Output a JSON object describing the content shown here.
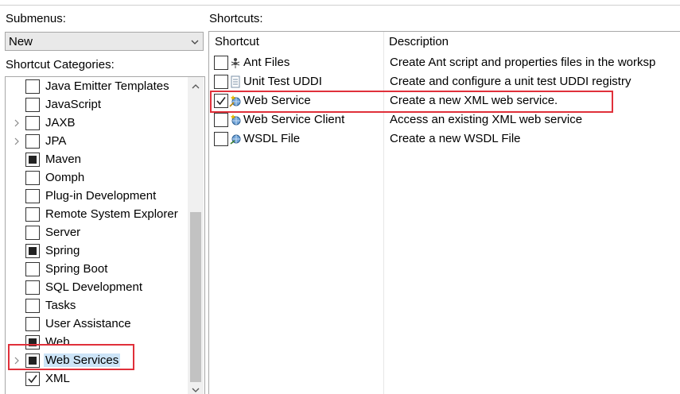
{
  "submenus": {
    "label": "Submenus:",
    "selected": "New"
  },
  "categories": {
    "label": "Shortcut Categories:",
    "items": [
      {
        "label": "Java Emitter Templates",
        "state": "unchecked",
        "expandable": false,
        "selected": false
      },
      {
        "label": "JavaScript",
        "state": "unchecked",
        "expandable": false,
        "selected": false
      },
      {
        "label": "JAXB",
        "state": "unchecked",
        "expandable": true,
        "selected": false
      },
      {
        "label": "JPA",
        "state": "unchecked",
        "expandable": true,
        "selected": false
      },
      {
        "label": "Maven",
        "state": "partial",
        "expandable": false,
        "selected": false
      },
      {
        "label": "Oomph",
        "state": "unchecked",
        "expandable": false,
        "selected": false
      },
      {
        "label": "Plug-in Development",
        "state": "unchecked",
        "expandable": false,
        "selected": false
      },
      {
        "label": "Remote System Explorer",
        "state": "unchecked",
        "expandable": false,
        "selected": false
      },
      {
        "label": "Server",
        "state": "unchecked",
        "expandable": false,
        "selected": false
      },
      {
        "label": "Spring",
        "state": "partial",
        "expandable": false,
        "selected": false
      },
      {
        "label": "Spring Boot",
        "state": "unchecked",
        "expandable": false,
        "selected": false
      },
      {
        "label": "SQL Development",
        "state": "unchecked",
        "expandable": false,
        "selected": false
      },
      {
        "label": "Tasks",
        "state": "unchecked",
        "expandable": false,
        "selected": false
      },
      {
        "label": "User Assistance",
        "state": "unchecked",
        "expandable": false,
        "selected": false
      },
      {
        "label": "Web",
        "state": "partial",
        "expandable": false,
        "selected": false
      },
      {
        "label": "Web Services",
        "state": "partial",
        "expandable": true,
        "selected": true
      },
      {
        "label": "XML",
        "state": "checked",
        "expandable": false,
        "selected": false
      }
    ]
  },
  "shortcuts": {
    "label": "Shortcuts:",
    "columns": [
      "Shortcut",
      "Description"
    ],
    "rows": [
      {
        "name": "Ant Files",
        "description": "Create Ant script and properties files in the worksp",
        "checked": false,
        "icon": "ant-icon"
      },
      {
        "name": "Unit Test UDDI",
        "description": "Create and configure a unit test UDDI registry",
        "checked": false,
        "icon": "document-icon"
      },
      {
        "name": "Web Service",
        "description": "Create a new XML web service.",
        "checked": true,
        "icon": "web-service-wizard-icon"
      },
      {
        "name": "Web Service Client",
        "description": "Access an existing XML web service",
        "checked": false,
        "icon": "web-service-client-icon"
      },
      {
        "name": "WSDL File",
        "description": "Create a new WSDL File",
        "checked": false,
        "icon": "wsdl-file-icon"
      }
    ]
  },
  "colors": {
    "highlight_box": "#e0303a",
    "selection_bg": "#cce4f7"
  }
}
